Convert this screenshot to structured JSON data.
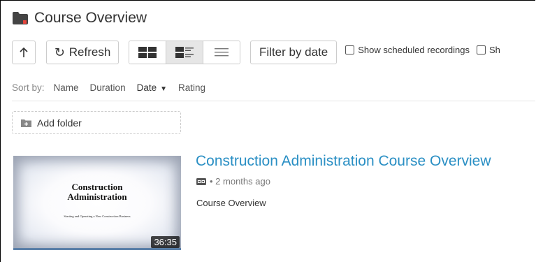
{
  "header": {
    "title": "Course Overview",
    "folder_color": "#444444",
    "folder_accent": "#e8453c"
  },
  "toolbar": {
    "up_icon": "arrow-up-icon",
    "refresh_label": "Refresh",
    "filter_label": "Filter by date",
    "views": [
      "thumbnail-view-icon",
      "detail-view-icon",
      "list-view-icon"
    ],
    "active_view": "detail-view-icon",
    "checkbox_scheduled": "Show scheduled recordings",
    "checkbox_cut": "Sh"
  },
  "sort": {
    "label": "Sort by:",
    "options": [
      "Name",
      "Duration",
      "Date",
      "Rating"
    ],
    "active": "Date",
    "direction": "descending"
  },
  "add_folder": {
    "label": "Add folder"
  },
  "session": {
    "title": "Construction Administration Course Overview",
    "meta": "• 2 months ago",
    "description": "Course Overview",
    "duration": "36:35",
    "thumbnail": {
      "title_line1": "Construction",
      "title_line2": "Administration",
      "subtitle": "Starting and Operating a New Construction Business"
    },
    "link_color": "#2a8fc4"
  }
}
